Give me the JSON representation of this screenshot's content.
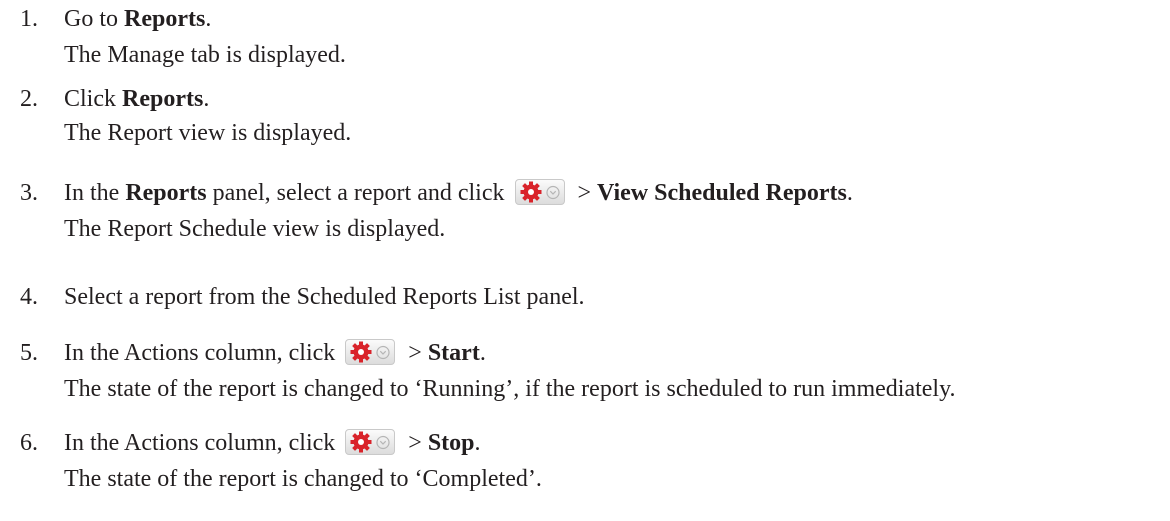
{
  "steps": [
    {
      "num": "1.",
      "text_pre": "Go to ",
      "bold1": "Reports",
      "text_post": ".",
      "result": "The Manage tab is displayed."
    },
    {
      "num": "2.",
      "text_pre": "Click ",
      "bold1": "Reports",
      "text_post": ".",
      "result": "The Report view is displayed."
    },
    {
      "num": "3.",
      "text_pre": "In the ",
      "bold1": "Reports",
      "text_mid": " panel, select a report and click ",
      "after_icon": " > ",
      "bold2": "View Scheduled Reports",
      "text_post": ".",
      "result": "The Report Schedule view is displayed."
    },
    {
      "num": "4.",
      "text": "Select a report from the Scheduled Reports List panel."
    },
    {
      "num": "5.",
      "text_pre": "In the Actions column, click ",
      "after_icon": " > ",
      "bold1": "Start",
      "text_post": ".",
      "result": "The state of the report is changed to ‘Running’, if the report is scheduled to run immediately."
    },
    {
      "num": "6.",
      "text_pre": "In the Actions column, click ",
      "after_icon": " > ",
      "bold1": "Stop",
      "text_post": ".",
      "result": "The state of the report is changed to ‘Completed’."
    }
  ],
  "icons": {
    "actions_menu": "gear-dropdown-icon",
    "gear_color": "#d9232a"
  }
}
